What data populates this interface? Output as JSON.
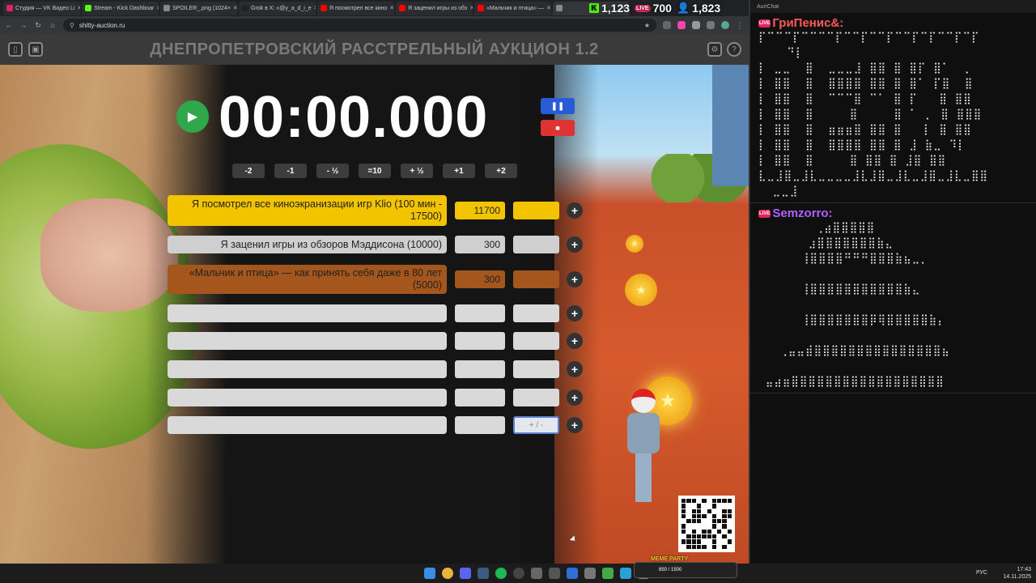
{
  "browser": {
    "tabs": [
      {
        "title": "Студия — VK Видео Li",
        "color": "#e0245e"
      },
      {
        "title": "Stream - Kick Dashboar",
        "color": "#53fc18"
      },
      {
        "title": "SPOILER_.png (1024×",
        "color": "#888888"
      },
      {
        "title": "Grok в X: «@y_a_d_i_e",
        "color": "#222222"
      },
      {
        "title": "Я посмотрел все кино",
        "color": "#ff0000"
      },
      {
        "title": "Я заценил игры из обз",
        "color": "#ff0000"
      },
      {
        "title": "«Мальчик и птица» —",
        "color": "#ff0000"
      },
      {
        "title": "",
        "color": "#888888"
      }
    ],
    "url": "shitty-auction.ru"
  },
  "stream_stats": {
    "kick_viewers": "1,123",
    "live_viewers": "700",
    "total_viewers": "1,823",
    "live_label": "LIVE"
  },
  "app": {
    "title": "ДНЕПРОПЕТРОВСКИЙ РАССТРЕЛЬНЫЙ АУКЦИОН 1.2",
    "timer": "00:00.000",
    "adjust_buttons": [
      "-2",
      "-1",
      "- ½",
      "=10",
      "+ ½",
      "+1",
      "+2"
    ],
    "plus_label": "+",
    "input_placeholder": "+ / -",
    "lots": [
      {
        "name": "Я посмотрел все киноэкранизации игр Klio (100 мин - 17500)",
        "amount": "11700",
        "style": "gold"
      },
      {
        "name": "Я заценил игры из обзоров Мэддисона (10000)",
        "amount": "300",
        "style": "silver"
      },
      {
        "name": "«Мальчик и птица» — как принять себя даже в 80 лет (5000)",
        "amount": "300",
        "style": "bronze"
      },
      {
        "name": "",
        "amount": "",
        "style": "empty"
      },
      {
        "name": "",
        "amount": "",
        "style": "empty"
      },
      {
        "name": "",
        "amount": "",
        "style": "empty"
      },
      {
        "name": "",
        "amount": "",
        "style": "empty"
      },
      {
        "name": "",
        "amount": "",
        "style": "empty"
      }
    ]
  },
  "chat": {
    "window_title": "AuriChat",
    "messages": [
      {
        "user": "ГриПенис&:",
        "color": "#ff5a5a",
        "text": "⡏⠉⠉⠉⡏⠉⠉⠉⠉⡏⠉⠉⡏⠉⠉⡏⠉⠉⡏⠉⡏⠉⠉⡏⠉⡏\n    ⠙⡇\n⡇ ⣀⣀  ⣿  ⣀⣀⣀⣸ ⣿⣿ ⣿ ⣿⡏ ⣿⠁  ⡀\n⡇ ⣿⣿  ⣿  ⣿⣿⣿⣿ ⣿⣿ ⣿ ⣿⠁ ⡏⣿  ⣿\n⡇ ⣿⣿  ⣿  ⠉⠉⠉⣿ ⠉⠁ ⣿ ⡏   ⣿ ⣿⣿\n⡇ ⣿⣿  ⣿     ⣿     ⣿ ⠁ ⡀ ⣿ ⣿⣿⣿\n⡇ ⣿⣿  ⣿  ⣶⣶⣶⣿ ⣿⣿ ⣿   ⡇ ⣿ ⣿⣿\n⡇ ⣿⣿  ⣿  ⣿⣿⣿⣿ ⣿⣿ ⣿ ⣸ ⣷⣀ ⠹⡇\n⡇ ⣿⣿  ⣿     ⣿ ⣿⣿ ⣿ ⣸⣿ ⣿⣿\n⣇⣀⣸⣿⣀⣸⣇⣀⣀⣀⣀⣸⣇⣸⣿⣀⣸⣇⣀⣸⣿⣀⣸⣇⣀⣿⣿\n  ⣀⣀⣸"
      },
      {
        "user": "Semzorro:",
        "color": "#b061ff",
        "text": "        ⢀⣴⣿⣿⣿⣿⣿\n       ⣰⣿⣿⣿⣿⣿⣿⣿⣷⣄\n      ⢸⣿⣿⣿⣿⠛⠛⠛⣿⣿⣿⣷⣦⣀⡀\n\n      ⢸⣿⣿⣿⣿⣿⣿⣿⣿⣿⣿⣿⣷⣄\n\n      ⢸⣿⣿⣿⣿⣿⣿⣿⡿⢿⣿⣿⣿⣿⣿⣷⡄\n\n   ⢀⣤⣤⣾⣿⣿⣿⣿⣿⣿⣿⣿⣿⣿⣿⣿⣿⣿⣿⣦\n\n ⣤⣴⣶⣿⣿⣿⣿⣿⣿⣿⣿⣿⣿⣿⣿⣿⣿⣿⣿⣿⣿"
      }
    ]
  },
  "taskbar": {
    "lang": "РУС",
    "time": "17:43",
    "date": "14.11.2025",
    "meme_party": "MEME PARTY",
    "meme_progress": "850 / 1500"
  }
}
